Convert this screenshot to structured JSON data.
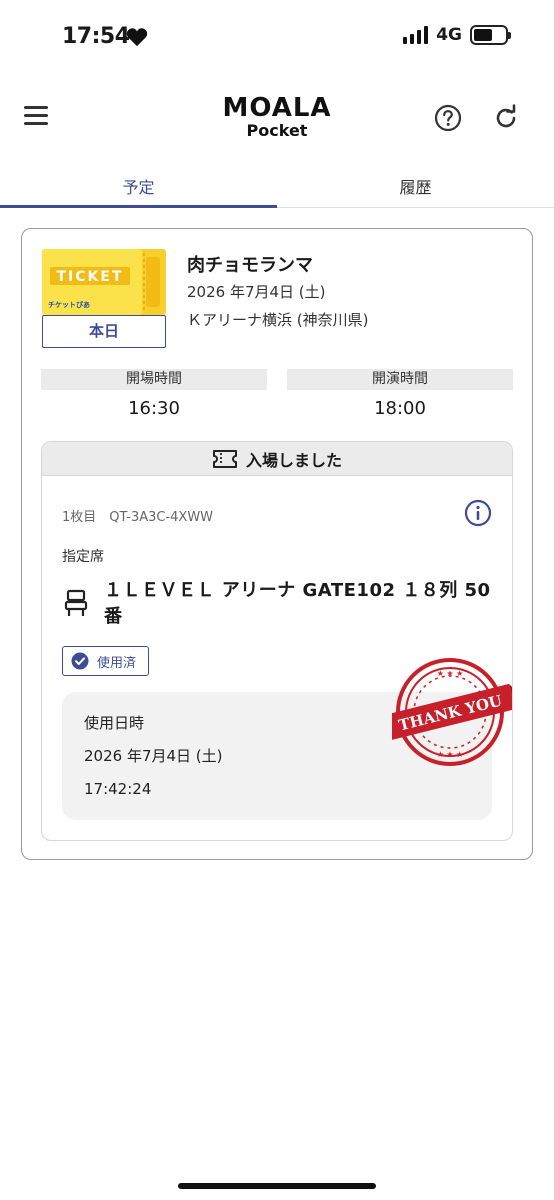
{
  "status_bar": {
    "time": "17:54",
    "network": "4G"
  },
  "header": {
    "logo_main": "MOALA",
    "logo_sub": "Pocket"
  },
  "tabs": [
    {
      "label": "予定",
      "active": true
    },
    {
      "label": "履歴",
      "active": false
    }
  ],
  "event": {
    "ticket_image_text": "TICKET",
    "ticket_image_brand": "チケットぴあ",
    "badge": "本日",
    "title": "肉チョモランマ",
    "date": "2026 年7月4日 (土)",
    "venue": "Ｋアリーナ横浜 (神奈川県)",
    "open_label": "開場時間",
    "open_time": "16:30",
    "start_label": "開演時間",
    "start_time": "18:00"
  },
  "entry": {
    "status": "入場しました",
    "ticket_number": "1枚目　QT-3A3C-4XWW",
    "seat_type": "指定席",
    "seat": "１ＬＥＶＥＬ アリーナ GATE102 １８列 50番",
    "used_badge": "使用済",
    "used_label": "使用日時",
    "used_date": "2026 年7月4日 (土)",
    "used_time": "17:42:24",
    "stamp_text": "THANK YOU"
  },
  "colors": {
    "accent": "#3e4c96",
    "stamp_red": "#c8202a",
    "ticket_yellow": "#f5c518"
  }
}
